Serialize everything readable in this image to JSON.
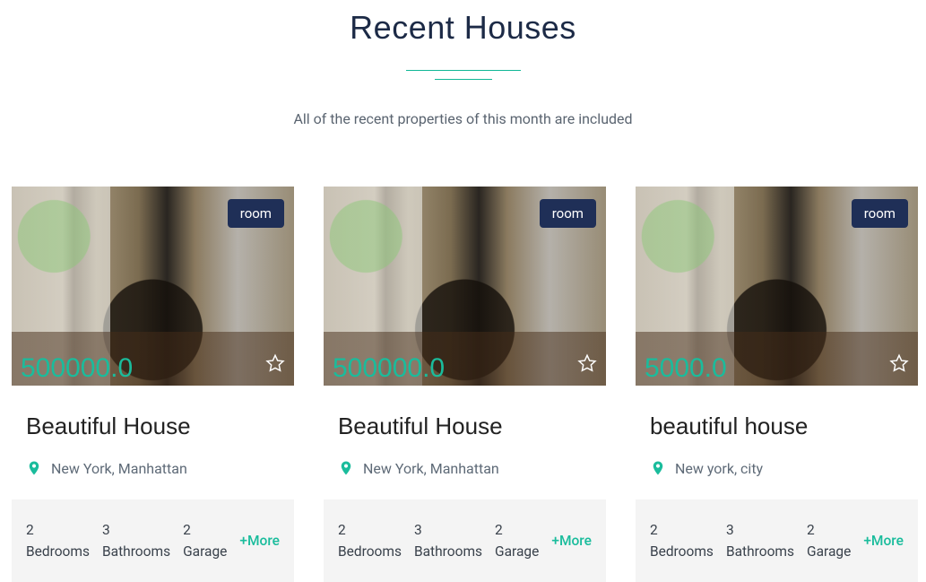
{
  "header": {
    "title": "Recent Houses",
    "subtitle": "All of the recent properties of this month are included"
  },
  "labels": {
    "bedrooms": "Bedrooms",
    "bathrooms": "Bathrooms",
    "garage": "Garage",
    "more": "+More"
  },
  "listings": [
    {
      "badge": "room",
      "price": "500000.0",
      "title": "Beautiful House",
      "location": "New York, Manhattan",
      "bedrooms": "2",
      "bathrooms": "3",
      "garage": "2"
    },
    {
      "badge": "room",
      "price": "500000.0",
      "title": "Beautiful House",
      "location": "New York, Manhattan",
      "bedrooms": "2",
      "bathrooms": "3",
      "garage": "2"
    },
    {
      "badge": "room",
      "price": "5000.0",
      "title": "beautiful house",
      "location": "New york, city",
      "bedrooms": "2",
      "bathrooms": "3",
      "garage": "2"
    }
  ]
}
